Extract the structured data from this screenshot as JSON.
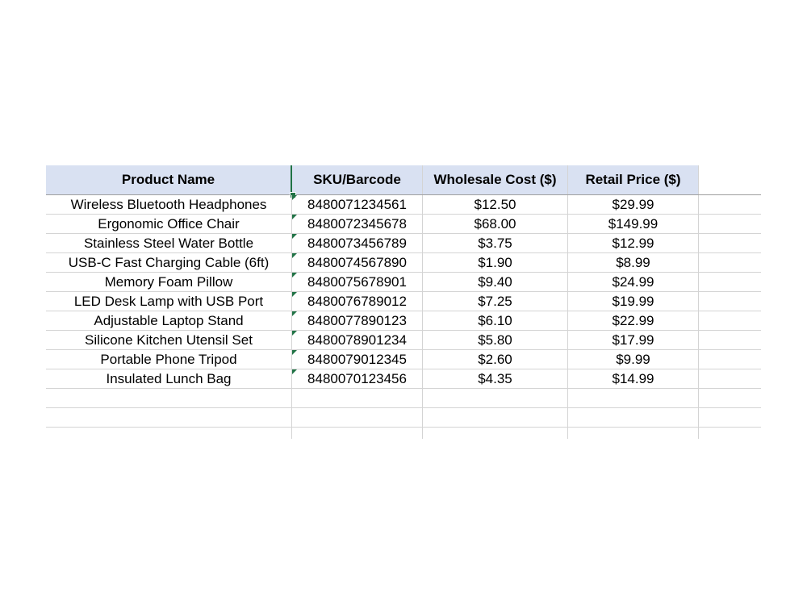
{
  "table": {
    "headers": [
      "Product Name",
      "SKU/Barcode",
      "Wholesale Cost ($)",
      "Retail Price ($)"
    ],
    "rows": [
      {
        "product": "Wireless Bluetooth Headphones",
        "sku": "8480071234561",
        "wholesale": "$12.50",
        "retail": "$29.99"
      },
      {
        "product": "Ergonomic Office Chair",
        "sku": "8480072345678",
        "wholesale": "$68.00",
        "retail": "$149.99"
      },
      {
        "product": "Stainless Steel Water Bottle",
        "sku": "8480073456789",
        "wholesale": "$3.75",
        "retail": "$12.99"
      },
      {
        "product": "USB-C Fast Charging Cable (6ft)",
        "sku": "8480074567890",
        "wholesale": "$1.90",
        "retail": "$8.99"
      },
      {
        "product": "Memory Foam Pillow",
        "sku": "8480075678901",
        "wholesale": "$9.40",
        "retail": "$24.99"
      },
      {
        "product": "LED Desk Lamp with USB Port",
        "sku": "8480076789012",
        "wholesale": "$7.25",
        "retail": "$19.99"
      },
      {
        "product": "Adjustable Laptop Stand",
        "sku": "8480077890123",
        "wholesale": "$6.10",
        "retail": "$22.99"
      },
      {
        "product": "Silicone Kitchen Utensil Set",
        "sku": "8480078901234",
        "wholesale": "$5.80",
        "retail": "$17.99"
      },
      {
        "product": "Portable Phone Tripod",
        "sku": "8480079012345",
        "wholesale": "$2.60",
        "retail": "$9.99"
      },
      {
        "product": "Insulated Lunch Bag",
        "sku": "8480070123456",
        "wholesale": "$4.35",
        "retail": "$14.99"
      }
    ]
  },
  "colors": {
    "header_fill": "#d9e1f2",
    "gridline": "#d4d4d4",
    "accent": "#217346"
  }
}
